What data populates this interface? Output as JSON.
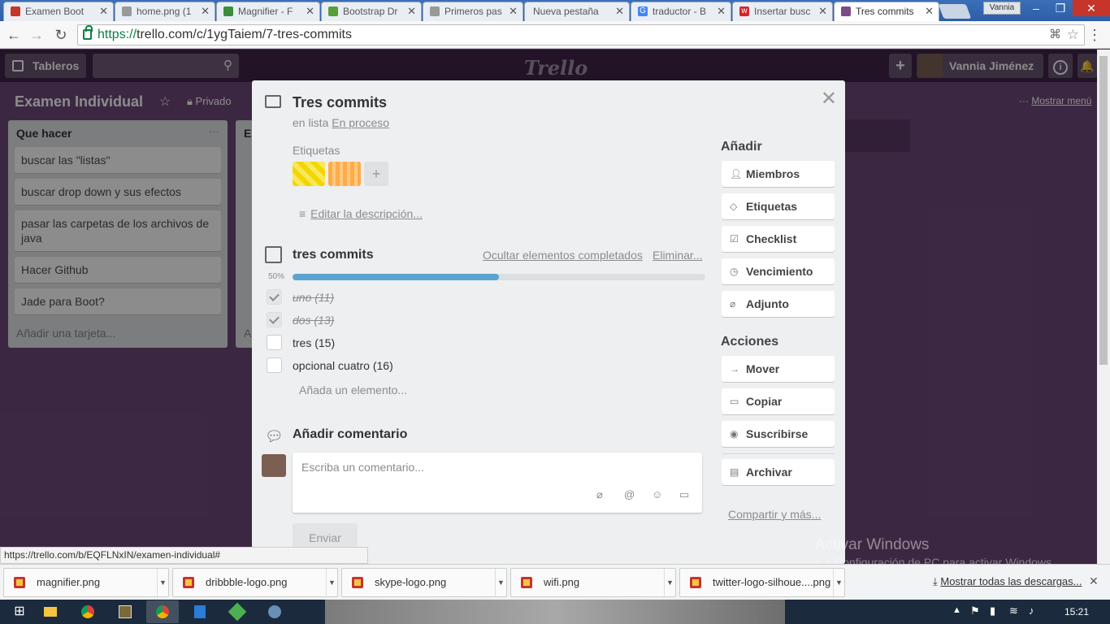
{
  "browser": {
    "tabs": [
      {
        "title": "Examen Boot",
        "icon": "pdf-icon"
      },
      {
        "title": "home.png (1",
        "icon": "page-icon"
      },
      {
        "title": "Magnifier - F",
        "icon": "magnifier-icon"
      },
      {
        "title": "Bootstrap Dr",
        "icon": "bootstrap-icon"
      },
      {
        "title": "Primeros pas",
        "icon": "page-icon"
      },
      {
        "title": "Nueva pestaña",
        "icon": "page-icon"
      },
      {
        "title": "traductor - B",
        "icon": "google-icon"
      },
      {
        "title": "Insertar busc",
        "icon": "w-icon"
      },
      {
        "title": "Tres commits",
        "icon": "trello-icon"
      }
    ],
    "user_chip": "Vannia",
    "url_scheme": "https://",
    "url_rest": "trello.com/c/1ygTaiem/7-tres-commits",
    "status_url": "https://trello.com/b/EQFLNxIN/examen-individual#"
  },
  "header": {
    "boards_label": "Tableros",
    "logo": "Trello",
    "user_name": "Vannia Jiménez",
    "add": "+",
    "info": "i"
  },
  "board": {
    "title": "Examen Individual",
    "privacy": "Privado",
    "show_menu": "Mostrar menú",
    "menu_dots": "···",
    "lists": [
      {
        "title": "Que hacer",
        "cards": [
          "buscar las \"listas\"",
          "buscar drop down y sus efectos",
          "pasar las carpetas de los archivos de java",
          "Hacer Github",
          "Jade para Boot?"
        ],
        "add_card": "Añadir una tarjeta..."
      },
      {
        "title": "E",
        "add_card": "A"
      }
    ]
  },
  "card": {
    "title": "Tres commits",
    "in_list_prefix": "en lista",
    "list_name": "En proceso",
    "labels_heading": "Etiquetas",
    "labels": [
      {
        "color": "#f2d600"
      },
      {
        "color": "#ffab4a"
      }
    ],
    "add_label": "+",
    "edit_description": "Editar la descripción...",
    "checklist": {
      "title": "tres commits",
      "hide_completed": "Ocultar elementos completados",
      "delete": "Eliminar...",
      "progress_label": "50%",
      "progress": 0.5,
      "items": [
        {
          "text": "uno (11)",
          "done": true
        },
        {
          "text": "dos (13)",
          "done": true
        },
        {
          "text": "tres (15)",
          "done": false
        },
        {
          "text": "opcional cuatro (16)",
          "done": false
        }
      ],
      "add_item": "Añada un elemento..."
    },
    "comment": {
      "heading": "Añadir comentario",
      "placeholder": "Escriba un comentario...",
      "send": "Enviar"
    },
    "sidebar": {
      "add_heading": "Añadir",
      "add_buttons": [
        "Miembros",
        "Etiquetas",
        "Checklist",
        "Vencimiento",
        "Adjunto"
      ],
      "actions_heading": "Acciones",
      "action_buttons": [
        "Mover",
        "Copiar",
        "Suscribirse"
      ],
      "archive": "Archivar",
      "share": "Compartir y más..."
    }
  },
  "watermark": {
    "line1": "Activar Windows",
    "line2": "Ir a Configuración de PC para activar Windows."
  },
  "downloads": {
    "files": [
      "magnifier.png",
      "dribbble-logo.png",
      "skype-logo.png",
      "wifi.png",
      "twitter-logo-silhoue....png"
    ],
    "show_all": "Mostrar todas las descargas..."
  },
  "taskbar": {
    "clock": "15:21"
  }
}
